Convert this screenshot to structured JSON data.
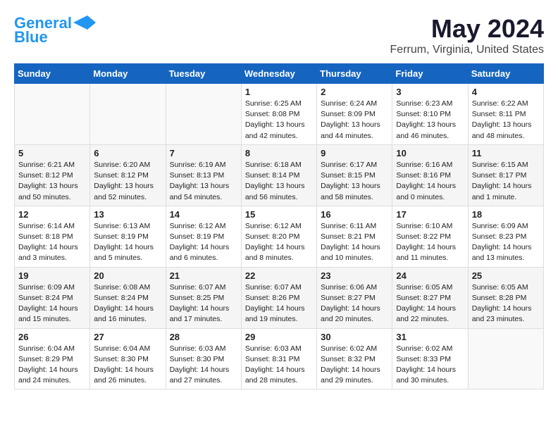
{
  "header": {
    "logo_general": "General",
    "logo_blue": "Blue",
    "month": "May 2024",
    "location": "Ferrum, Virginia, United States"
  },
  "weekdays": [
    "Sunday",
    "Monday",
    "Tuesday",
    "Wednesday",
    "Thursday",
    "Friday",
    "Saturday"
  ],
  "weeks": [
    [
      {
        "day": "",
        "info": ""
      },
      {
        "day": "",
        "info": ""
      },
      {
        "day": "",
        "info": ""
      },
      {
        "day": "1",
        "info": "Sunrise: 6:25 AM\nSunset: 8:08 PM\nDaylight: 13 hours\nand 42 minutes."
      },
      {
        "day": "2",
        "info": "Sunrise: 6:24 AM\nSunset: 8:09 PM\nDaylight: 13 hours\nand 44 minutes."
      },
      {
        "day": "3",
        "info": "Sunrise: 6:23 AM\nSunset: 8:10 PM\nDaylight: 13 hours\nand 46 minutes."
      },
      {
        "day": "4",
        "info": "Sunrise: 6:22 AM\nSunset: 8:11 PM\nDaylight: 13 hours\nand 48 minutes."
      }
    ],
    [
      {
        "day": "5",
        "info": "Sunrise: 6:21 AM\nSunset: 8:12 PM\nDaylight: 13 hours\nand 50 minutes."
      },
      {
        "day": "6",
        "info": "Sunrise: 6:20 AM\nSunset: 8:12 PM\nDaylight: 13 hours\nand 52 minutes."
      },
      {
        "day": "7",
        "info": "Sunrise: 6:19 AM\nSunset: 8:13 PM\nDaylight: 13 hours\nand 54 minutes."
      },
      {
        "day": "8",
        "info": "Sunrise: 6:18 AM\nSunset: 8:14 PM\nDaylight: 13 hours\nand 56 minutes."
      },
      {
        "day": "9",
        "info": "Sunrise: 6:17 AM\nSunset: 8:15 PM\nDaylight: 13 hours\nand 58 minutes."
      },
      {
        "day": "10",
        "info": "Sunrise: 6:16 AM\nSunset: 8:16 PM\nDaylight: 14 hours\nand 0 minutes."
      },
      {
        "day": "11",
        "info": "Sunrise: 6:15 AM\nSunset: 8:17 PM\nDaylight: 14 hours\nand 1 minute."
      }
    ],
    [
      {
        "day": "12",
        "info": "Sunrise: 6:14 AM\nSunset: 8:18 PM\nDaylight: 14 hours\nand 3 minutes."
      },
      {
        "day": "13",
        "info": "Sunrise: 6:13 AM\nSunset: 8:19 PM\nDaylight: 14 hours\nand 5 minutes."
      },
      {
        "day": "14",
        "info": "Sunrise: 6:12 AM\nSunset: 8:19 PM\nDaylight: 14 hours\nand 6 minutes."
      },
      {
        "day": "15",
        "info": "Sunrise: 6:12 AM\nSunset: 8:20 PM\nDaylight: 14 hours\nand 8 minutes."
      },
      {
        "day": "16",
        "info": "Sunrise: 6:11 AM\nSunset: 8:21 PM\nDaylight: 14 hours\nand 10 minutes."
      },
      {
        "day": "17",
        "info": "Sunrise: 6:10 AM\nSunset: 8:22 PM\nDaylight: 14 hours\nand 11 minutes."
      },
      {
        "day": "18",
        "info": "Sunrise: 6:09 AM\nSunset: 8:23 PM\nDaylight: 14 hours\nand 13 minutes."
      }
    ],
    [
      {
        "day": "19",
        "info": "Sunrise: 6:09 AM\nSunset: 8:24 PM\nDaylight: 14 hours\nand 15 minutes."
      },
      {
        "day": "20",
        "info": "Sunrise: 6:08 AM\nSunset: 8:24 PM\nDaylight: 14 hours\nand 16 minutes."
      },
      {
        "day": "21",
        "info": "Sunrise: 6:07 AM\nSunset: 8:25 PM\nDaylight: 14 hours\nand 17 minutes."
      },
      {
        "day": "22",
        "info": "Sunrise: 6:07 AM\nSunset: 8:26 PM\nDaylight: 14 hours\nand 19 minutes."
      },
      {
        "day": "23",
        "info": "Sunrise: 6:06 AM\nSunset: 8:27 PM\nDaylight: 14 hours\nand 20 minutes."
      },
      {
        "day": "24",
        "info": "Sunrise: 6:05 AM\nSunset: 8:27 PM\nDaylight: 14 hours\nand 22 minutes."
      },
      {
        "day": "25",
        "info": "Sunrise: 6:05 AM\nSunset: 8:28 PM\nDaylight: 14 hours\nand 23 minutes."
      }
    ],
    [
      {
        "day": "26",
        "info": "Sunrise: 6:04 AM\nSunset: 8:29 PM\nDaylight: 14 hours\nand 24 minutes."
      },
      {
        "day": "27",
        "info": "Sunrise: 6:04 AM\nSunset: 8:30 PM\nDaylight: 14 hours\nand 26 minutes."
      },
      {
        "day": "28",
        "info": "Sunrise: 6:03 AM\nSunset: 8:30 PM\nDaylight: 14 hours\nand 27 minutes."
      },
      {
        "day": "29",
        "info": "Sunrise: 6:03 AM\nSunset: 8:31 PM\nDaylight: 14 hours\nand 28 minutes."
      },
      {
        "day": "30",
        "info": "Sunrise: 6:02 AM\nSunset: 8:32 PM\nDaylight: 14 hours\nand 29 minutes."
      },
      {
        "day": "31",
        "info": "Sunrise: 6:02 AM\nSunset: 8:33 PM\nDaylight: 14 hours\nand 30 minutes."
      },
      {
        "day": "",
        "info": ""
      }
    ]
  ]
}
